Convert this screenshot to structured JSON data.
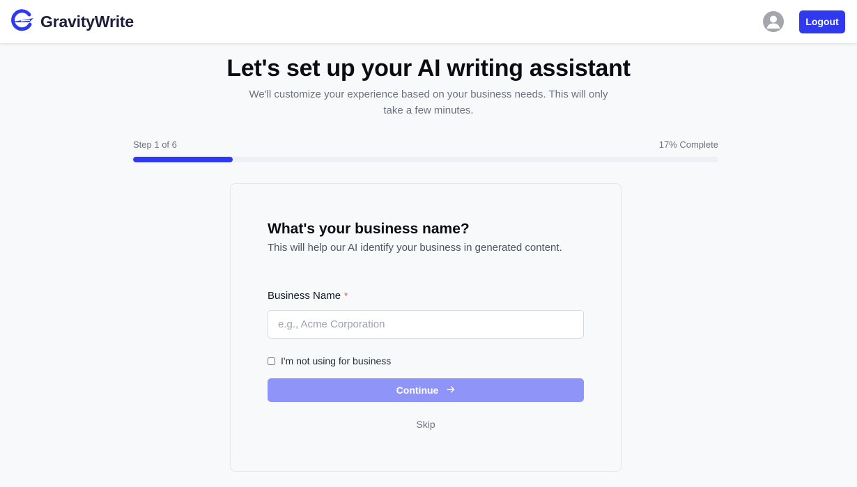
{
  "header": {
    "brand_name": "GravityWrite",
    "logout_label": "Logout"
  },
  "hero": {
    "title": "Let's set up your AI writing assistant",
    "subtitle": "We'll customize your experience based on your business needs. This will only take a few minutes."
  },
  "progress": {
    "step_label": "Step 1 of 6",
    "complete_label": "17% Complete",
    "percent": 17
  },
  "form": {
    "question": "What's your business name?",
    "helper": "This will help our AI identify your business in generated content.",
    "field_label": "Business Name",
    "required_mark": "*",
    "input_value": "",
    "input_placeholder": "e.g., Acme Corporation",
    "checkbox_label": "I'm not using for business",
    "checkbox_checked": false,
    "continue_label": "Continue",
    "skip_label": "Skip"
  },
  "colors": {
    "accent": "#2f3af0",
    "accent_disabled": "#8f95f8",
    "required": "#ef4444",
    "page_bg": "#f8f9fb"
  },
  "icons": {
    "logo": "gravitywrite-g-logo-icon",
    "avatar": "user-avatar-icon",
    "continue": "arrow-right-icon"
  }
}
